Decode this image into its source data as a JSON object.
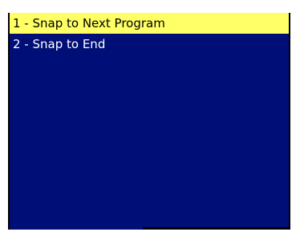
{
  "menu": {
    "items": [
      {
        "label": "1 - Snap to Next Program",
        "selected": true
      },
      {
        "label": "2 - Snap to End",
        "selected": false
      }
    ]
  },
  "colors": {
    "panel_background": "#000f77",
    "selected_background": "#ffff66",
    "selected_text": "#000000",
    "item_text": "#ffffff"
  }
}
